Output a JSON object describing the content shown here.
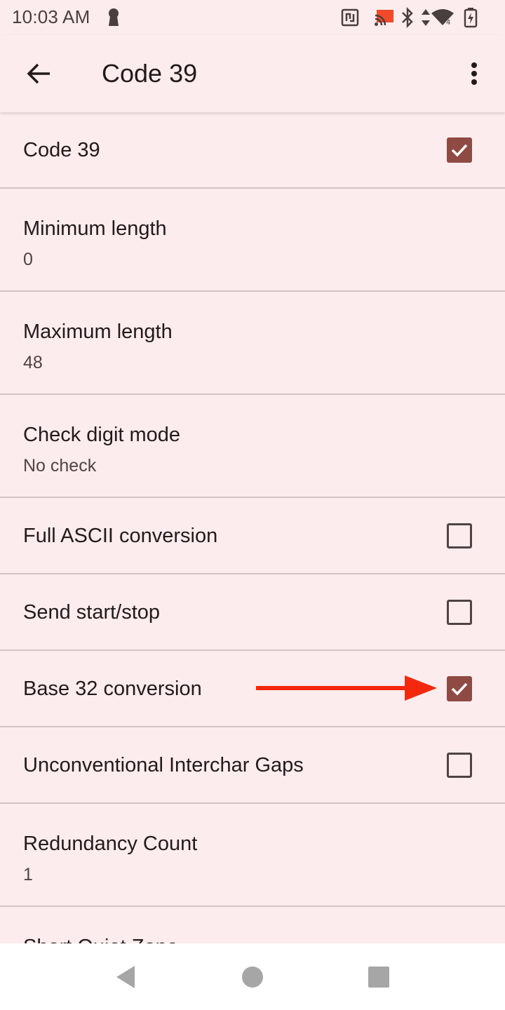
{
  "status_bar": {
    "time": "10:03 AM",
    "icons": [
      "keyhole-icon",
      "nfc-icon",
      "cast-icon",
      "bluetooth-icon",
      "data-arrows-icon",
      "wifi-icon",
      "battery-charging-icon"
    ]
  },
  "app_bar": {
    "title": "Code 39",
    "back_icon": "arrow-back-icon",
    "menu_icon": "more-vert-icon"
  },
  "preferences": [
    {
      "title": "Code 39",
      "type": "checkbox",
      "checked": true
    },
    {
      "title": "Minimum length",
      "summary": "0"
    },
    {
      "title": "Maximum length",
      "summary": "48"
    },
    {
      "title": "Check digit mode",
      "summary": "No check"
    },
    {
      "title": "Full ASCII conversion",
      "type": "checkbox",
      "checked": false
    },
    {
      "title": "Send start/stop",
      "type": "checkbox",
      "checked": false
    },
    {
      "title": "Base 32 conversion",
      "type": "checkbox",
      "checked": true,
      "annotation": "red-arrow"
    },
    {
      "title": "Unconventional Interchar Gaps",
      "type": "checkbox",
      "checked": false
    },
    {
      "title": "Redundancy Count",
      "summary": "1"
    },
    {
      "title": "Short Quiet Zone"
    }
  ],
  "nav_bar": {
    "icons": [
      "nav-back-icon",
      "nav-home-icon",
      "nav-recents-icon"
    ]
  },
  "colors": {
    "background": "#fdeced",
    "accent": "#8f4a44",
    "divider": "#d3c4c4",
    "annotation_arrow": "#f4280d"
  }
}
